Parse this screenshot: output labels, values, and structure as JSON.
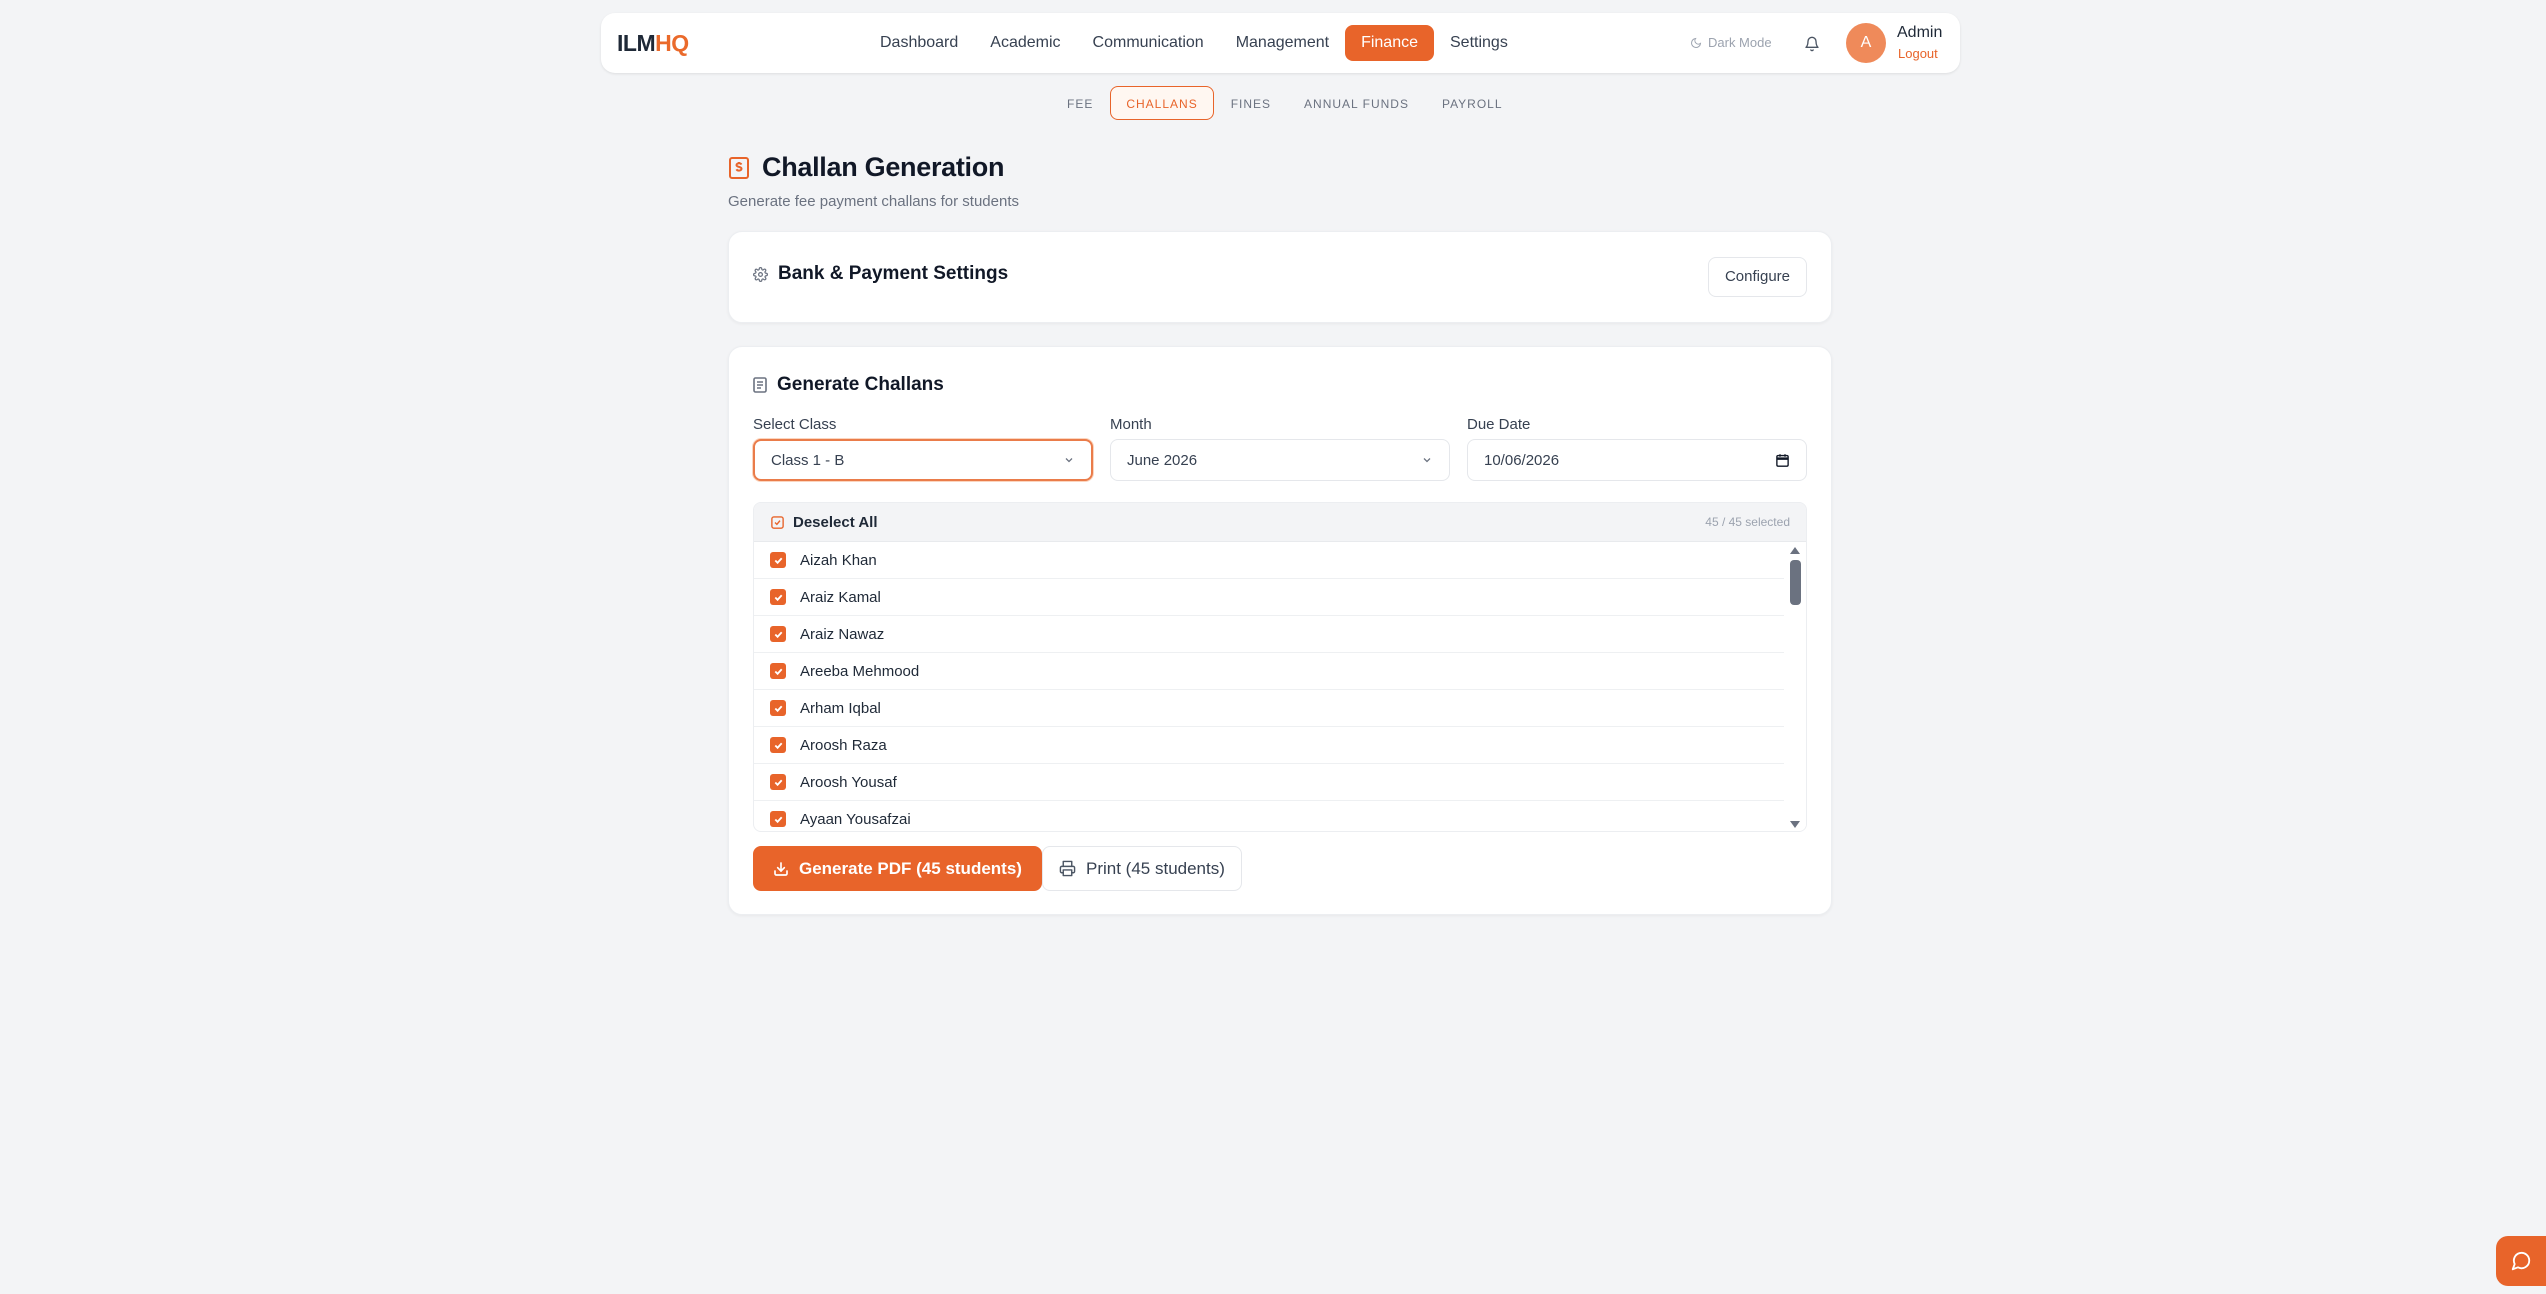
{
  "brand": {
    "part1": "ILM",
    "part2": "HQ",
    "accent": "#e8642a"
  },
  "nav": {
    "links": [
      {
        "label": "Dashboard"
      },
      {
        "label": "Academic"
      },
      {
        "label": "Communication"
      },
      {
        "label": "Management"
      },
      {
        "label": "Finance"
      },
      {
        "label": "Settings"
      }
    ],
    "active": "Finance",
    "dark_mode_label": "Dark Mode",
    "user": {
      "initial": "A",
      "name": "Admin",
      "logout_label": "Logout"
    }
  },
  "subtabs": [
    {
      "label": "FEE"
    },
    {
      "label": "CHALLANS"
    },
    {
      "label": "FINES"
    },
    {
      "label": "ANNUAL FUNDS"
    },
    {
      "label": "PAYROLL"
    }
  ],
  "active_subtab": "CHALLANS",
  "page": {
    "title": "Challan Generation",
    "subtitle": "Generate fee payment challans for students"
  },
  "bank_card": {
    "title": "Bank & Payment Settings",
    "configure_label": "Configure"
  },
  "generate_card": {
    "title": "Generate Challans",
    "class_label": "Select Class",
    "class_value": "Class 1 - B",
    "month_label": "Month",
    "month_value": "June 2026",
    "due_label": "Due Date",
    "due_value": "10/06/2026",
    "deselect_label": "Deselect All",
    "selected_count": "45 / 45 selected",
    "students": [
      "Aizah Khan",
      "Araiz Kamal",
      "Araiz Nawaz",
      "Areeba Mehmood",
      "Arham Iqbal",
      "Aroosh Raza",
      "Aroosh Yousaf",
      "Ayaan Yousafzai"
    ],
    "pdf_label": "Generate PDF (45 students)",
    "print_label": "Print (45 students)"
  }
}
